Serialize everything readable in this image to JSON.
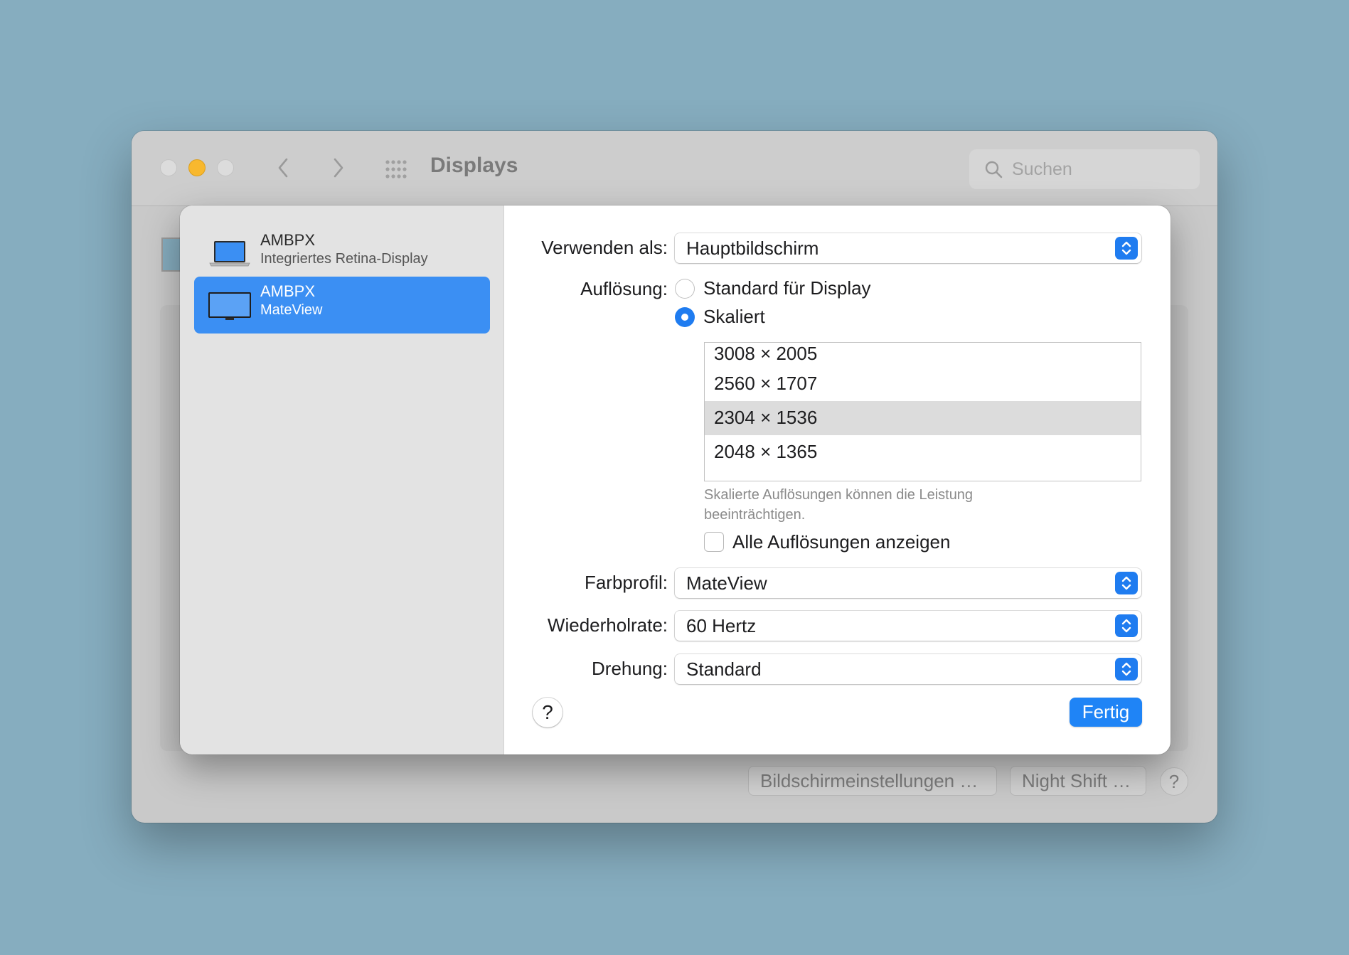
{
  "window": {
    "title": "Displays",
    "search_placeholder": "Suchen",
    "buttons": {
      "bildschirmeinstellungen": "Bildschirmeinstellungen …",
      "night_shift": "Night Shift …",
      "help": "?"
    }
  },
  "sheet": {
    "displays": [
      {
        "name": "AMBPX",
        "subtitle": "Integriertes Retina-Display",
        "icon": "laptop-icon",
        "selected": false
      },
      {
        "name": "AMBPX",
        "subtitle": "MateView",
        "icon": "monitor-icon",
        "selected": true
      }
    ],
    "use_as": {
      "label": "Verwenden als:",
      "value": "Hauptbildschirm"
    },
    "resolution": {
      "label": "Auflösung:",
      "options": [
        "Standard für Display",
        "Skaliert"
      ],
      "selected_option": "Skaliert",
      "list": [
        "3008 × 2005",
        "2560 × 1707",
        "2304 × 1536",
        "2048 × 1365"
      ],
      "selected_resolution": "2304 × 1536",
      "hint": "Skalierte Auflösungen können die Leistung beeinträchtigen.",
      "show_all_label": "Alle Auflösungen anzeigen",
      "show_all_checked": false
    },
    "color_profile": {
      "label": "Farbprofil:",
      "value": "MateView"
    },
    "refresh_rate": {
      "label": "Wiederholrate:",
      "value": "60 Hertz"
    },
    "rotation": {
      "label": "Drehung:",
      "value": "Standard"
    },
    "help_label": "?",
    "done_label": "Fertig"
  },
  "colors": {
    "accent": "#1f7cf0",
    "selected_row": "#3b8ff3",
    "desktop": "#86adbf"
  }
}
